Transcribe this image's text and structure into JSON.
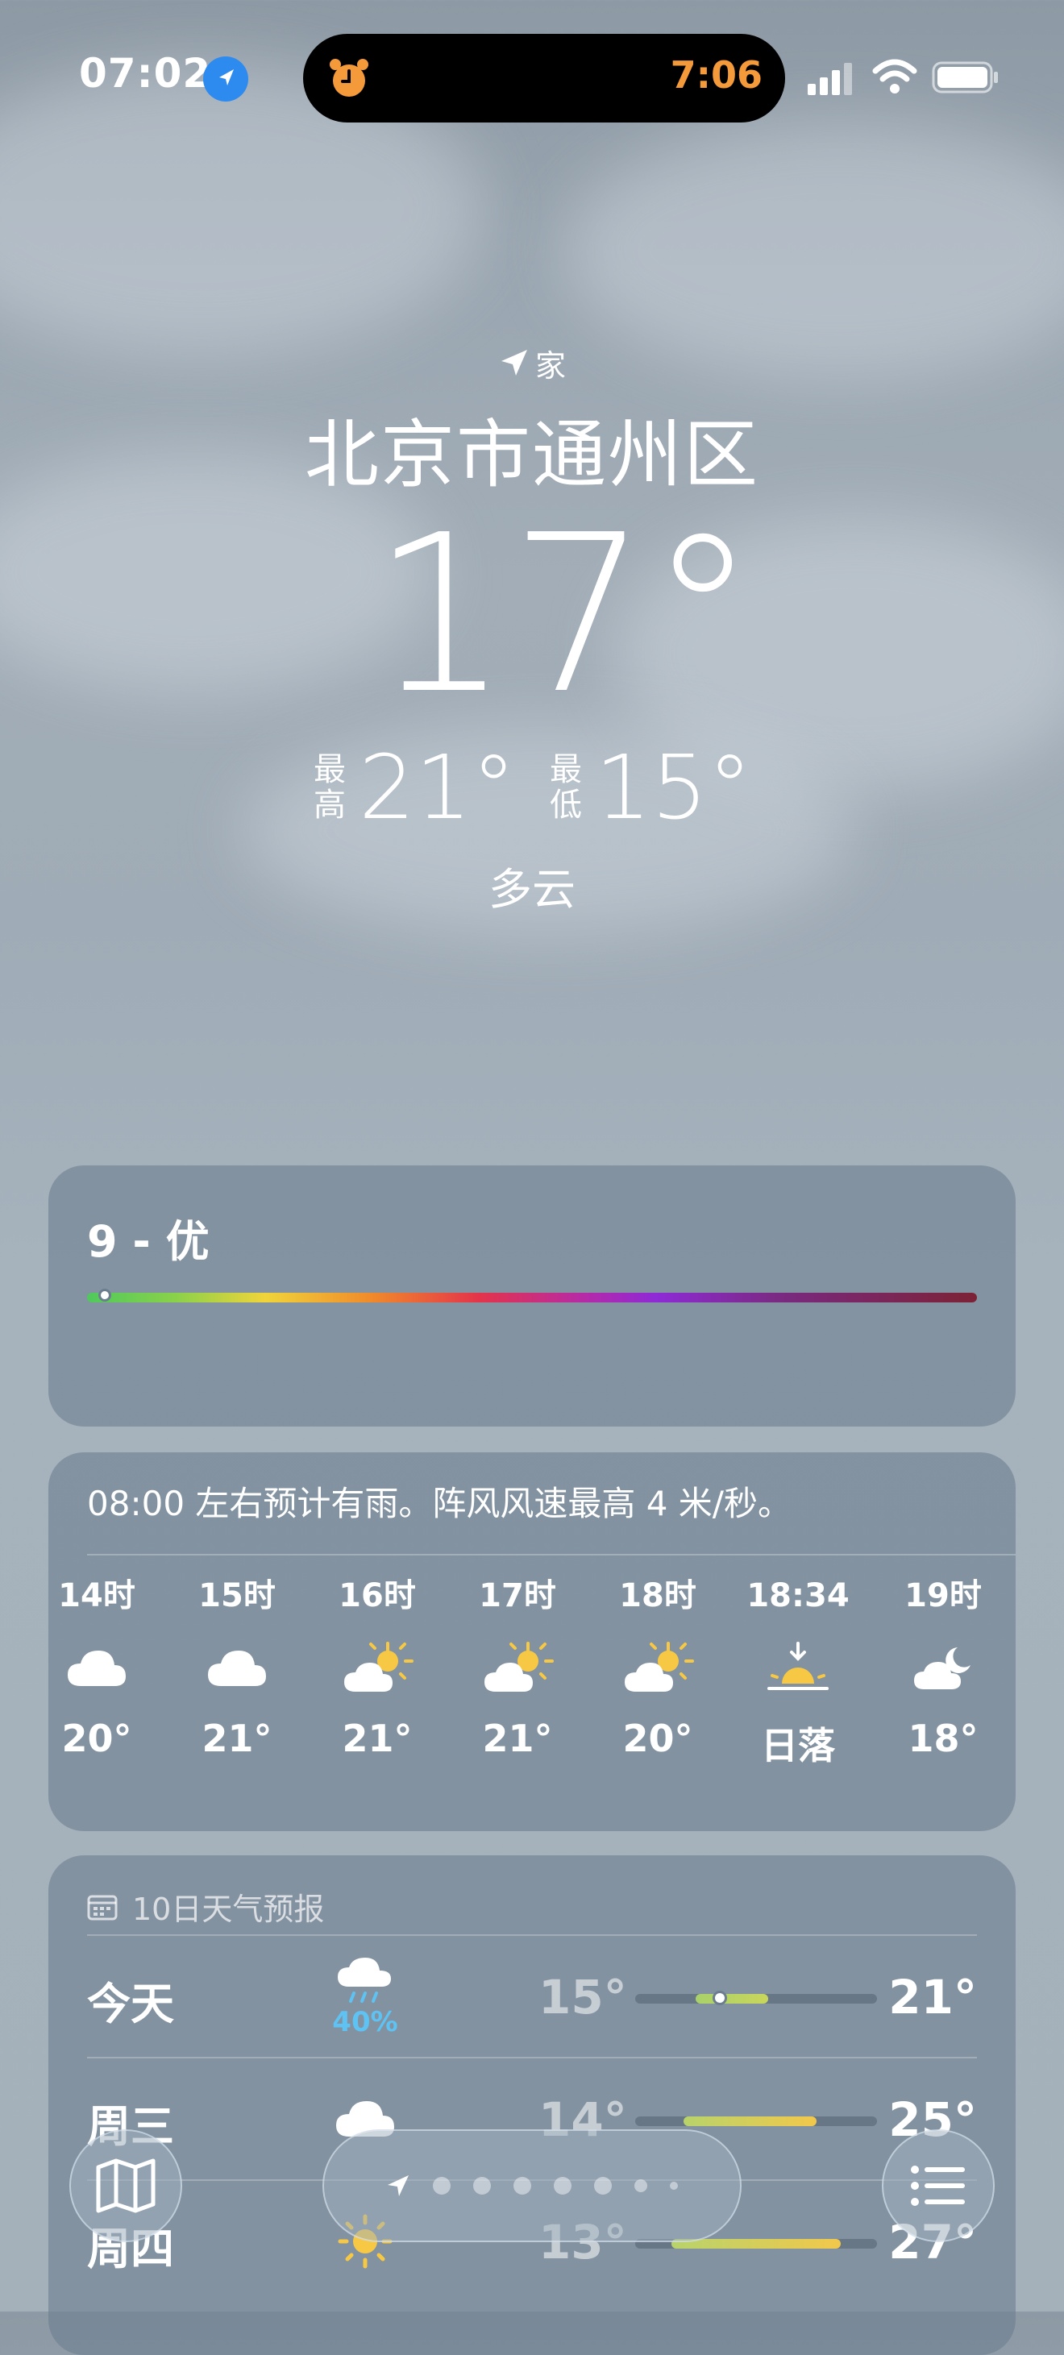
{
  "status_bar": {
    "time": "07:02",
    "alarm_time": "7:06",
    "location_icon": "location-arrow-icon",
    "alarm_icon": "alarm-clock-icon"
  },
  "header": {
    "home_label": "家",
    "city": "北京市通州区",
    "temperature": "17°",
    "high_label": "最高",
    "high": "21°",
    "low_label": "最低",
    "low": "15°",
    "condition": "多云"
  },
  "air_quality": {
    "title": "9 - 优",
    "level_fraction": 0.02
  },
  "hourly": {
    "summary": "08:00 左右预计有雨。阵风风速最高 4 米/秒。",
    "items": [
      {
        "label": "14时",
        "icon": "cloud-icon",
        "temp": "20°"
      },
      {
        "label": "15时",
        "icon": "cloud-icon",
        "temp": "21°"
      },
      {
        "label": "16时",
        "icon": "partly-sunny-icon",
        "temp": "21°"
      },
      {
        "label": "17时",
        "icon": "partly-sunny-icon",
        "temp": "21°"
      },
      {
        "label": "18时",
        "icon": "partly-sunny-icon",
        "temp": "20°"
      },
      {
        "label": "18:34",
        "icon": "sunset-icon",
        "temp": "日落"
      },
      {
        "label": "19时",
        "icon": "partly-cloudy-night-icon",
        "temp": "18°"
      }
    ]
  },
  "daily": {
    "title": "10日天气预报",
    "days": [
      {
        "name": "今天",
        "icon": "rain-cloud-icon",
        "pop": "40%",
        "low": "15°",
        "high": "21°"
      },
      {
        "name": "周三",
        "icon": "cloud-icon",
        "pop": "",
        "low": "14°",
        "high": "25°"
      },
      {
        "name": "周四",
        "icon": "sun-icon",
        "pop": "",
        "low": "13°",
        "high": "27°"
      }
    ]
  },
  "colors": {
    "island_time": "#f49a3a",
    "location_blue": "#2d8bf0",
    "pop_blue": "#5ec2f2",
    "sun_yellow": "#f7c843"
  }
}
